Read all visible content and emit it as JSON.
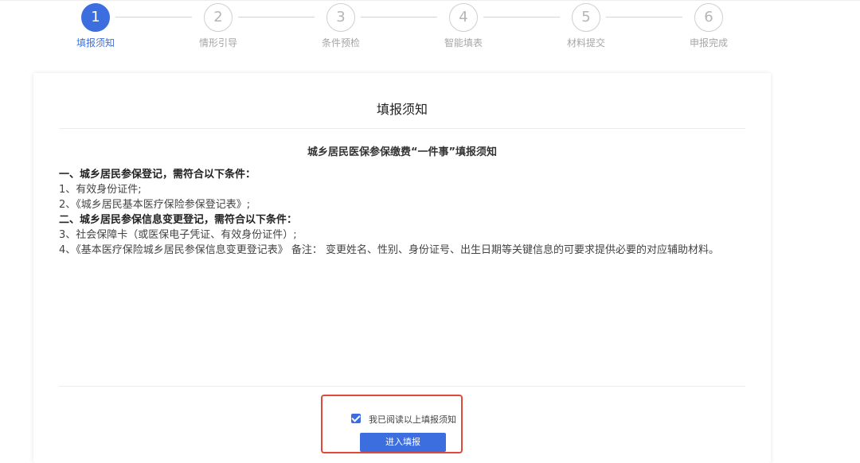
{
  "steps": [
    {
      "number": "1",
      "label": "填报须知"
    },
    {
      "number": "2",
      "label": "情形引导"
    },
    {
      "number": "3",
      "label": "条件预检"
    },
    {
      "number": "4",
      "label": "智能填表"
    },
    {
      "number": "5",
      "label": "材料提交"
    },
    {
      "number": "6",
      "label": "申报完成"
    }
  ],
  "active_step": 1,
  "card": {
    "title": "填报须知",
    "heading": "城乡居民医保参保缴费“一件事”填报须知",
    "lines": [
      {
        "text": "一、城乡居民参保登记，需符合以下条件：",
        "bold": true
      },
      {
        "text": "1、有效身份证件;",
        "bold": false
      },
      {
        "text": "2、《城乡居民基本医疗保险参保登记表》;",
        "bold": false
      },
      {
        "text": "二、城乡居民参保信息变更登记，需符合以下条件：",
        "bold": true
      },
      {
        "text": "3、社会保障卡（或医保电子凭证、有效身份证件）;",
        "bold": false
      },
      {
        "text": "4、《基本医疗保险城乡居民参保信息变更登记表》 备注： 变更姓名、性别、身份证号、出生日期等关键信息的可要求提供必要的对应辅助材料。",
        "bold": false
      }
    ]
  },
  "confirm": {
    "checkbox_label": "我已阅读以上填报须知",
    "checked": true,
    "button_label": "进入填报"
  },
  "colors": {
    "accent": "#3d6ee0",
    "highlight_border": "#e04a3a"
  }
}
